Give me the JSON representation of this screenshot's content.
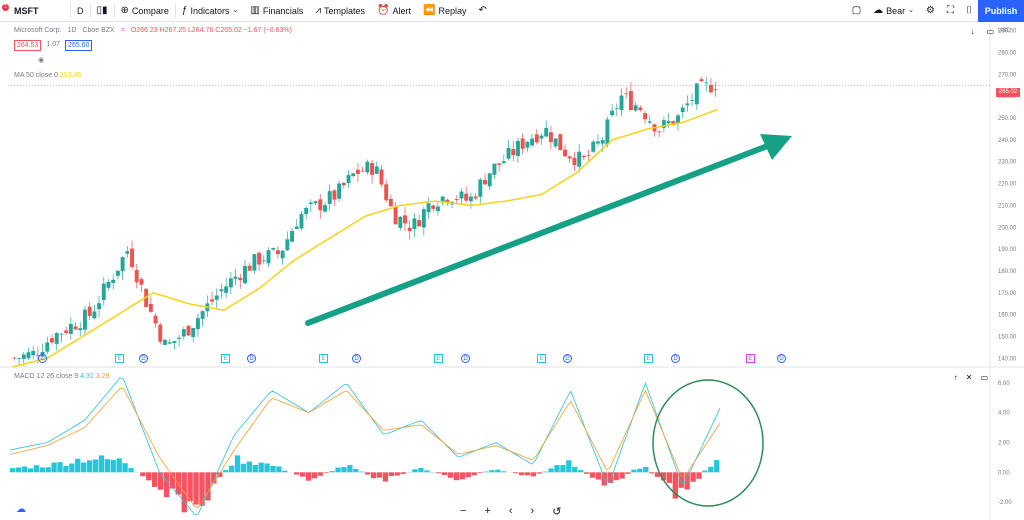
{
  "toolbar": {
    "symbol": "MSFT",
    "interval": "D",
    "compare": "Compare",
    "indicators": "Indicators",
    "financials": "Financials",
    "templates": "Templates",
    "alert": "Alert",
    "replay": "Replay",
    "bear": "Bear",
    "publish": "Publish",
    "notification_count": "1"
  },
  "legend": {
    "title": "Microsoft Corp.",
    "interval": "1D",
    "exchange": "Cboe BZX",
    "ohlc": "O266.23 H267.25 L264.76 C265.02 −1.67 (−0.63%)",
    "bid": "264.53",
    "spread": "1.07",
    "ask": "265.60",
    "ma": "MA 50 close 0",
    "ma_value": "253.45",
    "macd": "MACD 12 26 close 9",
    "macd_v1": "4.31",
    "macd_v2": "3.29"
  },
  "price_axis": {
    "currency": "USD",
    "ticks": [
      "290.00",
      "280.00",
      "270.00",
      "260.00",
      "250.00",
      "240.00",
      "230.00",
      "220.00",
      "210.00",
      "200.00",
      "190.00",
      "180.00",
      "170.00",
      "160.00",
      "150.00",
      "140.00"
    ],
    "last_price": "265.02",
    "macd_ticks": [
      "6.00",
      "4.00",
      "2.00",
      "0.00",
      "-2.00"
    ]
  },
  "events": [
    "D",
    "E",
    "D",
    "E",
    "D",
    "E",
    "D",
    "E",
    "D",
    "E",
    "D",
    "E",
    "D",
    "E",
    "D"
  ],
  "colors": {
    "up": "#26a69a",
    "down": "#ef5350",
    "ma": "#f7d319",
    "arrow": "#16a085",
    "circle": "#2e8b57",
    "macd": "#2bc2d8",
    "signal": "#f0a030",
    "hist_up": "#26c6da",
    "hist_down": "#f7525f"
  },
  "chart_data": {
    "type": "line",
    "title": "Microsoft Corp. 1D Cboe BZX",
    "price_range": [
      136,
      294
    ],
    "macd_range": [
      -3.2,
      7
    ],
    "close_approx": [
      140,
      142,
      150,
      155,
      160,
      175,
      190,
      165,
      145,
      152,
      162,
      172,
      180,
      186,
      188,
      205,
      210,
      215,
      225,
      228,
      206,
      200,
      212,
      215,
      212,
      225,
      232,
      240,
      245,
      235,
      230,
      240,
      260,
      255,
      245,
      250,
      262,
      266
    ],
    "ma50_approx": [
      136,
      140,
      150,
      160,
      170,
      165,
      162,
      172,
      185,
      195,
      205,
      210,
      212,
      210,
      212,
      215,
      225,
      240,
      245,
      248,
      254
    ],
    "macd_approx": [
      1.5,
      2.0,
      3.5,
      6.5,
      0.0,
      -3.0,
      2.5,
      5.5,
      4.0,
      6.0,
      2.5,
      3.5,
      1.0,
      2.0,
      0.5,
      5.5,
      -1.0,
      6.0,
      -1.0,
      4.3
    ],
    "signal_approx": [
      1.2,
      1.8,
      3.0,
      5.8,
      1.0,
      -2.5,
      1.5,
      5.0,
      4.0,
      5.5,
      2.8,
      3.2,
      1.2,
      1.8,
      0.8,
      4.8,
      0.0,
      5.5,
      -0.5,
      3.3
    ],
    "histogram_approx": [
      0.3,
      0.5,
      1.0,
      0.8,
      -1.5,
      -2.5,
      1.0,
      0.5,
      -0.5,
      0.5,
      -0.6,
      0.3,
      -0.5,
      0.2,
      -0.3,
      0.7,
      -1.0,
      0.5,
      -1.8,
      1.0
    ]
  },
  "nav": {
    "zoom_out": "−",
    "zoom_in": "+",
    "left": "‹",
    "right": "›",
    "reset": "↺"
  }
}
